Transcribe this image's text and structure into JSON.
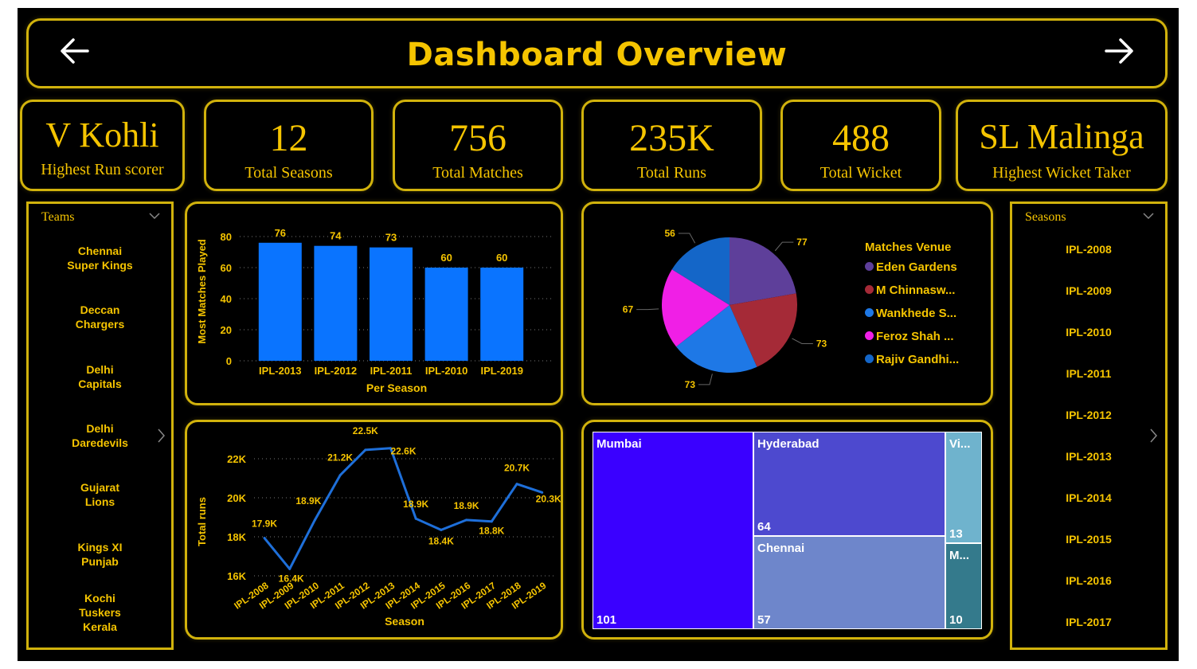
{
  "header": {
    "title": "Dashboard Overview"
  },
  "kpis": {
    "top_scorer": {
      "value": "V Kohli",
      "label": "Highest Run scorer"
    },
    "seasons": {
      "value": "12",
      "label": "Total Seasons"
    },
    "matches": {
      "value": "756",
      "label": "Total Matches"
    },
    "runs": {
      "value": "235K",
      "label": "Total Runs"
    },
    "wickets": {
      "value": "488",
      "label": "Total Wicket"
    },
    "top_bowler": {
      "value": "SL Malinga",
      "label": "Highest Wicket Taker"
    }
  },
  "teams_slicer": {
    "title": "Teams",
    "items": [
      "Chennai\nSuper Kings",
      "Deccan\nChargers",
      "Delhi\nCapitals",
      "Delhi\nDaredevils",
      "Gujarat\nLions",
      "Kings XI\nPunjab",
      "Kochi\nTuskers\nKerala"
    ]
  },
  "seasons_slicer": {
    "title": "Seasons",
    "items": [
      "IPL-2008",
      "IPL-2009",
      "IPL-2010",
      "IPL-2011",
      "IPL-2012",
      "IPL-2013",
      "IPL-2014",
      "IPL-2015",
      "IPL-2016",
      "IPL-2017"
    ]
  },
  "colors": {
    "accent": "#f5c400",
    "border": "#d1b20c",
    "bar": "#0a74ff",
    "line": "#1e6fd9"
  },
  "chart_data": [
    {
      "type": "bar",
      "categories": [
        "IPL-2013",
        "IPL-2012",
        "IPL-2011",
        "IPL-2010",
        "IPL-2019"
      ],
      "values": [
        76,
        74,
        73,
        60,
        60
      ],
      "xlabel": "Per Season",
      "ylabel": "Most Matches Played",
      "yticks": [
        0,
        20,
        40,
        60,
        80
      ],
      "ylim": [
        0,
        80
      ],
      "grid": true
    },
    {
      "type": "pie",
      "title": "Matches Venue",
      "legend_position": "right",
      "slices": [
        {
          "label": "Eden Gardens",
          "value": 77,
          "color": "#5e3f9a"
        },
        {
          "label": "M Chinnasw...",
          "value": 73,
          "color": "#a52a37"
        },
        {
          "label": "Wankhede S...",
          "value": 73,
          "color": "#1e78e6"
        },
        {
          "label": "Feroz Shah ...",
          "value": 67,
          "color": "#f01fe6"
        },
        {
          "label": "Rajiv Gandhi...",
          "value": 56,
          "color": "#1466c8"
        }
      ]
    },
    {
      "type": "line",
      "x": [
        "IPL-2008",
        "IPL-2009",
        "IPL-2010",
        "IPL-2011",
        "IPL-2012",
        "IPL-2013",
        "IPL-2014",
        "IPL-2015",
        "IPL-2016",
        "IPL-2017",
        "IPL-2018",
        "IPL-2019"
      ],
      "y": [
        17937,
        16353,
        18864,
        21154,
        22453,
        22541,
        18931,
        18353,
        18862,
        18786,
        20706,
        20272
      ],
      "labels": [
        "17.9K",
        "16.4K",
        "18.9K",
        "21.2K",
        "22.5K",
        "22.6K",
        "18.9K",
        "18.4K",
        "18.9K",
        "18.8K",
        "20.7K",
        "20.3K"
      ],
      "yticks": [
        "16K",
        "18K",
        "20K",
        "22K"
      ],
      "ylim": [
        16000,
        23000
      ],
      "xlabel": "Season",
      "ylabel": "Total runs",
      "grid": true
    },
    {
      "type": "treemap",
      "items": [
        {
          "label": "Mumbai",
          "value": 101,
          "color": "#3a00ff"
        },
        {
          "label": "Hyderabad",
          "value": 64,
          "color": "#4d49cf"
        },
        {
          "label": "Chennai",
          "value": 57,
          "color": "#6e86cb"
        },
        {
          "label": "Vi...",
          "value": 13,
          "color": "#6fb3cd"
        },
        {
          "label": "M...",
          "value": 10,
          "color": "#347a8c"
        }
      ]
    }
  ]
}
